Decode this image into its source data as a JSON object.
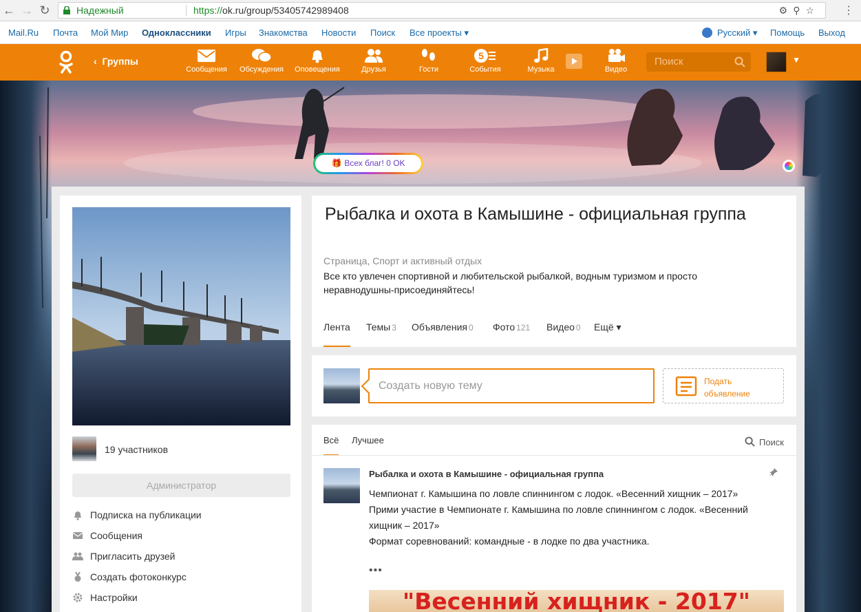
{
  "browser": {
    "secure_label": "Надежный",
    "url_protocol": "https://",
    "url_rest": "ok.ru/group/53405742989408"
  },
  "portal": {
    "links": [
      "Mail.Ru",
      "Почта",
      "Мой Мир",
      "Одноклассники",
      "Игры",
      "Знакомства",
      "Новости",
      "Поиск",
      "Все проекты ▾"
    ],
    "language": "Русский ▾",
    "help": "Помощь",
    "logout": "Выход"
  },
  "toolbar": {
    "back_label": "Группы",
    "items": [
      "Сообщения",
      "Обсуждения",
      "Оповещения",
      "Друзья",
      "Гости",
      "События",
      "Музыка",
      "Видео"
    ],
    "events_badge": "5",
    "search_placeholder": "Поиск",
    "brand_color": "#ee8208"
  },
  "cover": {
    "gift_label": "Всех благ! 0 OK"
  },
  "group": {
    "title": "Рыбалка и охота в Камышине - официальная группа",
    "category": "Страница, Спорт и активный отдых",
    "description": "Все кто увлечен спортивной и любительской рыбалкой, водным туризмом и просто неравнодушны-присоединяйтесь!",
    "members": "19 участников",
    "admin_button": "Администратор",
    "menu": [
      "Подписка на публикации",
      "Сообщения",
      "Пригласить друзей",
      "Создать фотоконкурс",
      "Настройки"
    ],
    "tabs": [
      {
        "label": "Лента",
        "count": ""
      },
      {
        "label": "Темы",
        "count": "3"
      },
      {
        "label": "Объявления",
        "count": "0"
      },
      {
        "label": "Фото",
        "count": "121"
      },
      {
        "label": "Видео",
        "count": "0"
      },
      {
        "label": "Ещё ▾",
        "count": ""
      }
    ]
  },
  "compose": {
    "placeholder": "Создать новую тему",
    "ad_label": "Подать объявление"
  },
  "feed": {
    "tabs": [
      "Всё",
      "Лучшее"
    ],
    "search_label": "Поиск",
    "post": {
      "author": "Рыбалка и охота в Камышине - официальная группа",
      "line1": "Чемпионат г. Камышина по ловле спиннингом с лодок.  «Весенний хищник – 2017»",
      "line2": "Прими участие в Чемпионате г. Камышина по ловле спиннингом с лодок. «Весенний хищник – 2017»",
      "line3": "Формат соревнований: командные - в лодке по два участника.",
      "more": "•••",
      "image_caption": "\"Весенний хищник - 2017\""
    }
  }
}
